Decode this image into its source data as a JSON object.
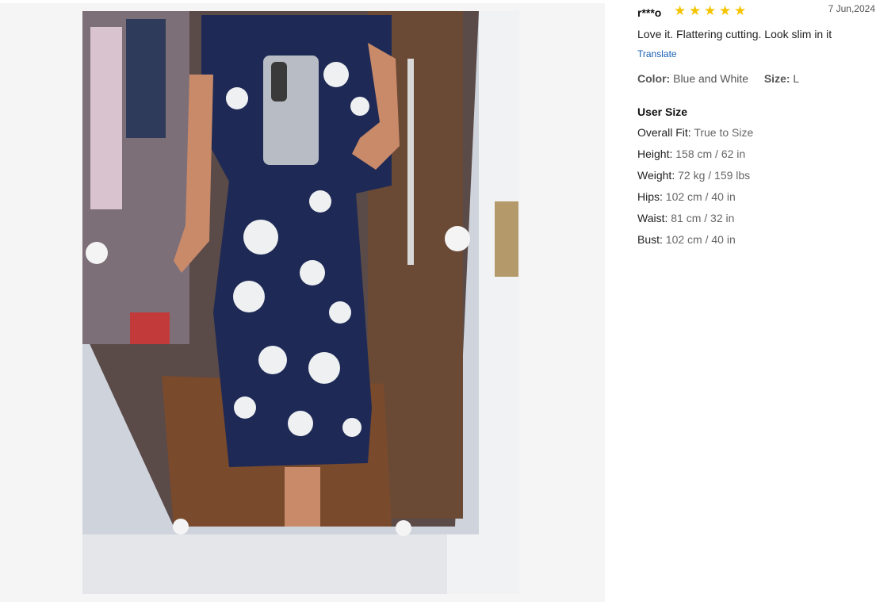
{
  "review": {
    "author": "r***o",
    "rating": 5,
    "rating_max": 5,
    "date": "7 Jun,2024",
    "comment": "Love it. Flattering cutting. Look slim in it",
    "translate_label": "Translate",
    "color_label": "Color:",
    "color_value": "Blue and White",
    "size_label": "Size:",
    "size_value": "L",
    "user_size_title": "User Size",
    "user_size": [
      {
        "label": "Overall Fit:",
        "value": "True to Size"
      },
      {
        "label": "Height:",
        "value": "158 cm / 62 in"
      },
      {
        "label": "Weight:",
        "value": "72 kg / 159 lbs"
      },
      {
        "label": "Hips:",
        "value": "102 cm / 40 in"
      },
      {
        "label": "Waist:",
        "value": "81 cm / 32 in"
      },
      {
        "label": "Bust:",
        "value": "102 cm / 40 in"
      }
    ]
  },
  "icons": {
    "star": "star-icon"
  },
  "colors": {
    "star": "#f5c400",
    "link": "#1a5fb4",
    "dress": "#1e2a55"
  }
}
